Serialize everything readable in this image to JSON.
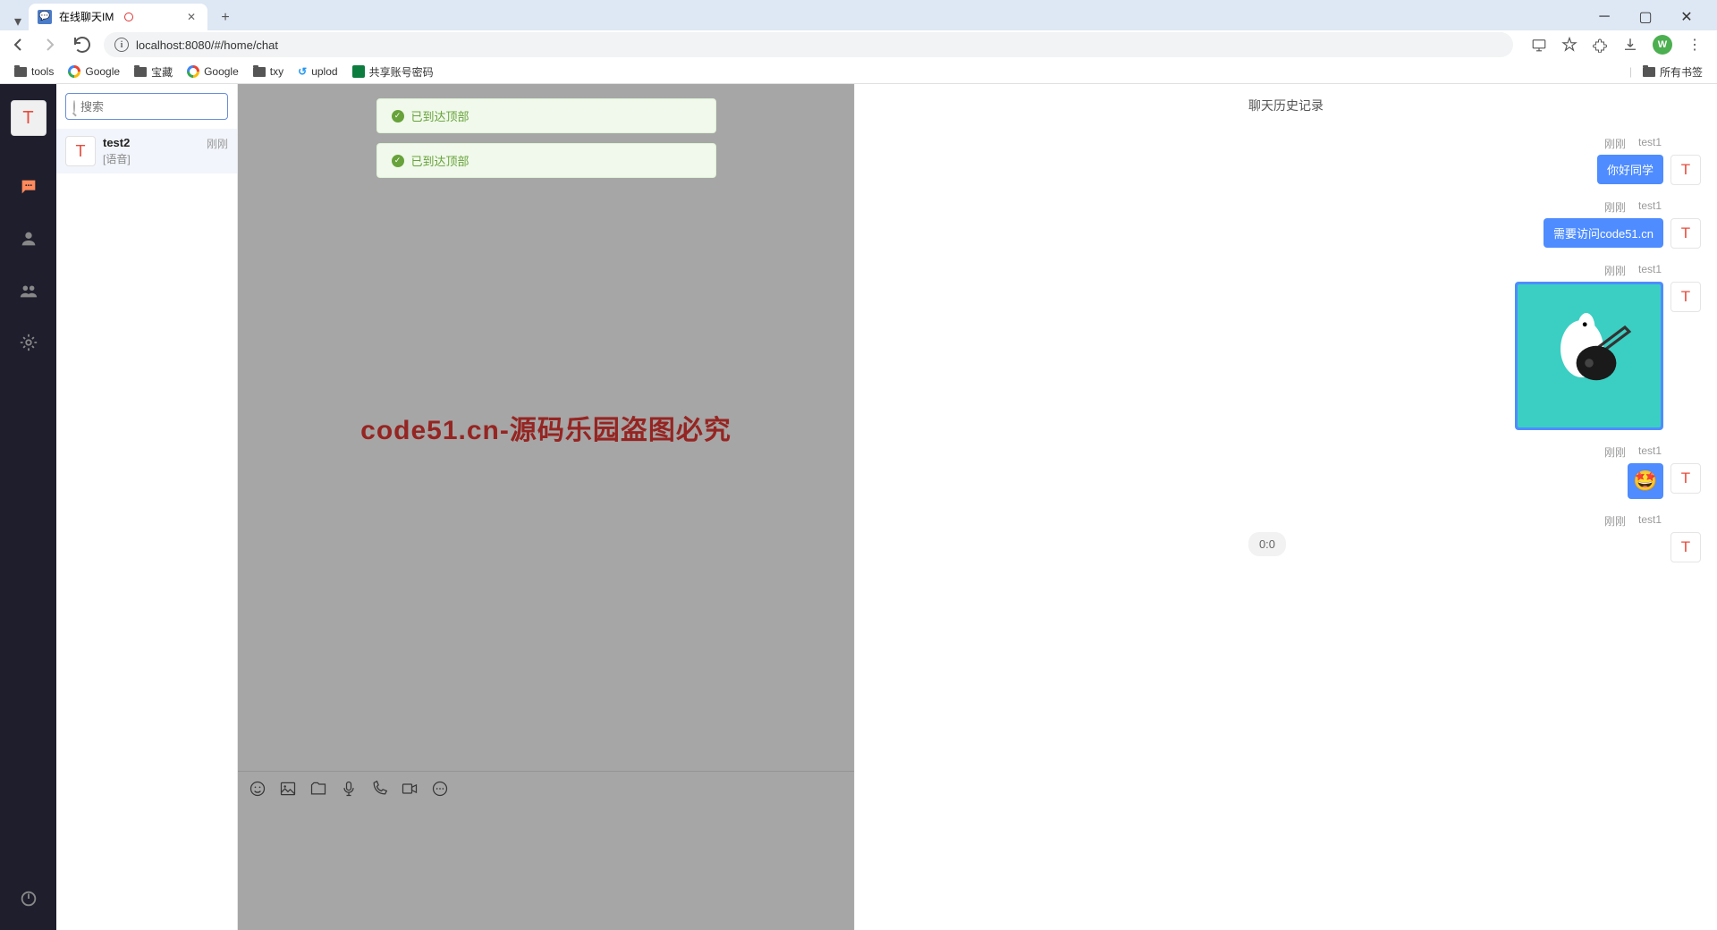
{
  "browser": {
    "tab_title": "在线聊天IM",
    "url": "localhost:8080/#/home/chat",
    "bookmarks": [
      "tools",
      "Google",
      "宝藏",
      "Google",
      "txy",
      "uplod",
      "共享账号密码"
    ],
    "all_bookmarks": "所有书签"
  },
  "sidebar": {
    "avatar_letter": "T"
  },
  "search": {
    "placeholder": "搜索"
  },
  "contacts": [
    {
      "avatar": "T",
      "name": "test2",
      "preview": "[语音]",
      "time": "刚刚"
    }
  ],
  "toasts": [
    "已到达顶部",
    "已到达顶部"
  ],
  "watermark": "code51.cn-源码乐园盗图必究",
  "history": {
    "title": "聊天历史记录",
    "messages": [
      {
        "time": "刚刚",
        "sender": "test1",
        "avatar": "T",
        "type": "text",
        "text": "你好同学"
      },
      {
        "time": "刚刚",
        "sender": "test1",
        "avatar": "T",
        "type": "text",
        "text": "需要访问code51.cn"
      },
      {
        "time": "刚刚",
        "sender": "test1",
        "avatar": "T",
        "type": "sticker"
      },
      {
        "time": "刚刚",
        "sender": "test1",
        "avatar": "T",
        "type": "emoji",
        "emoji": "🤩"
      },
      {
        "time": "刚刚",
        "sender": "test1",
        "avatar": "T",
        "type": "audio",
        "duration": "0:0"
      }
    ]
  }
}
